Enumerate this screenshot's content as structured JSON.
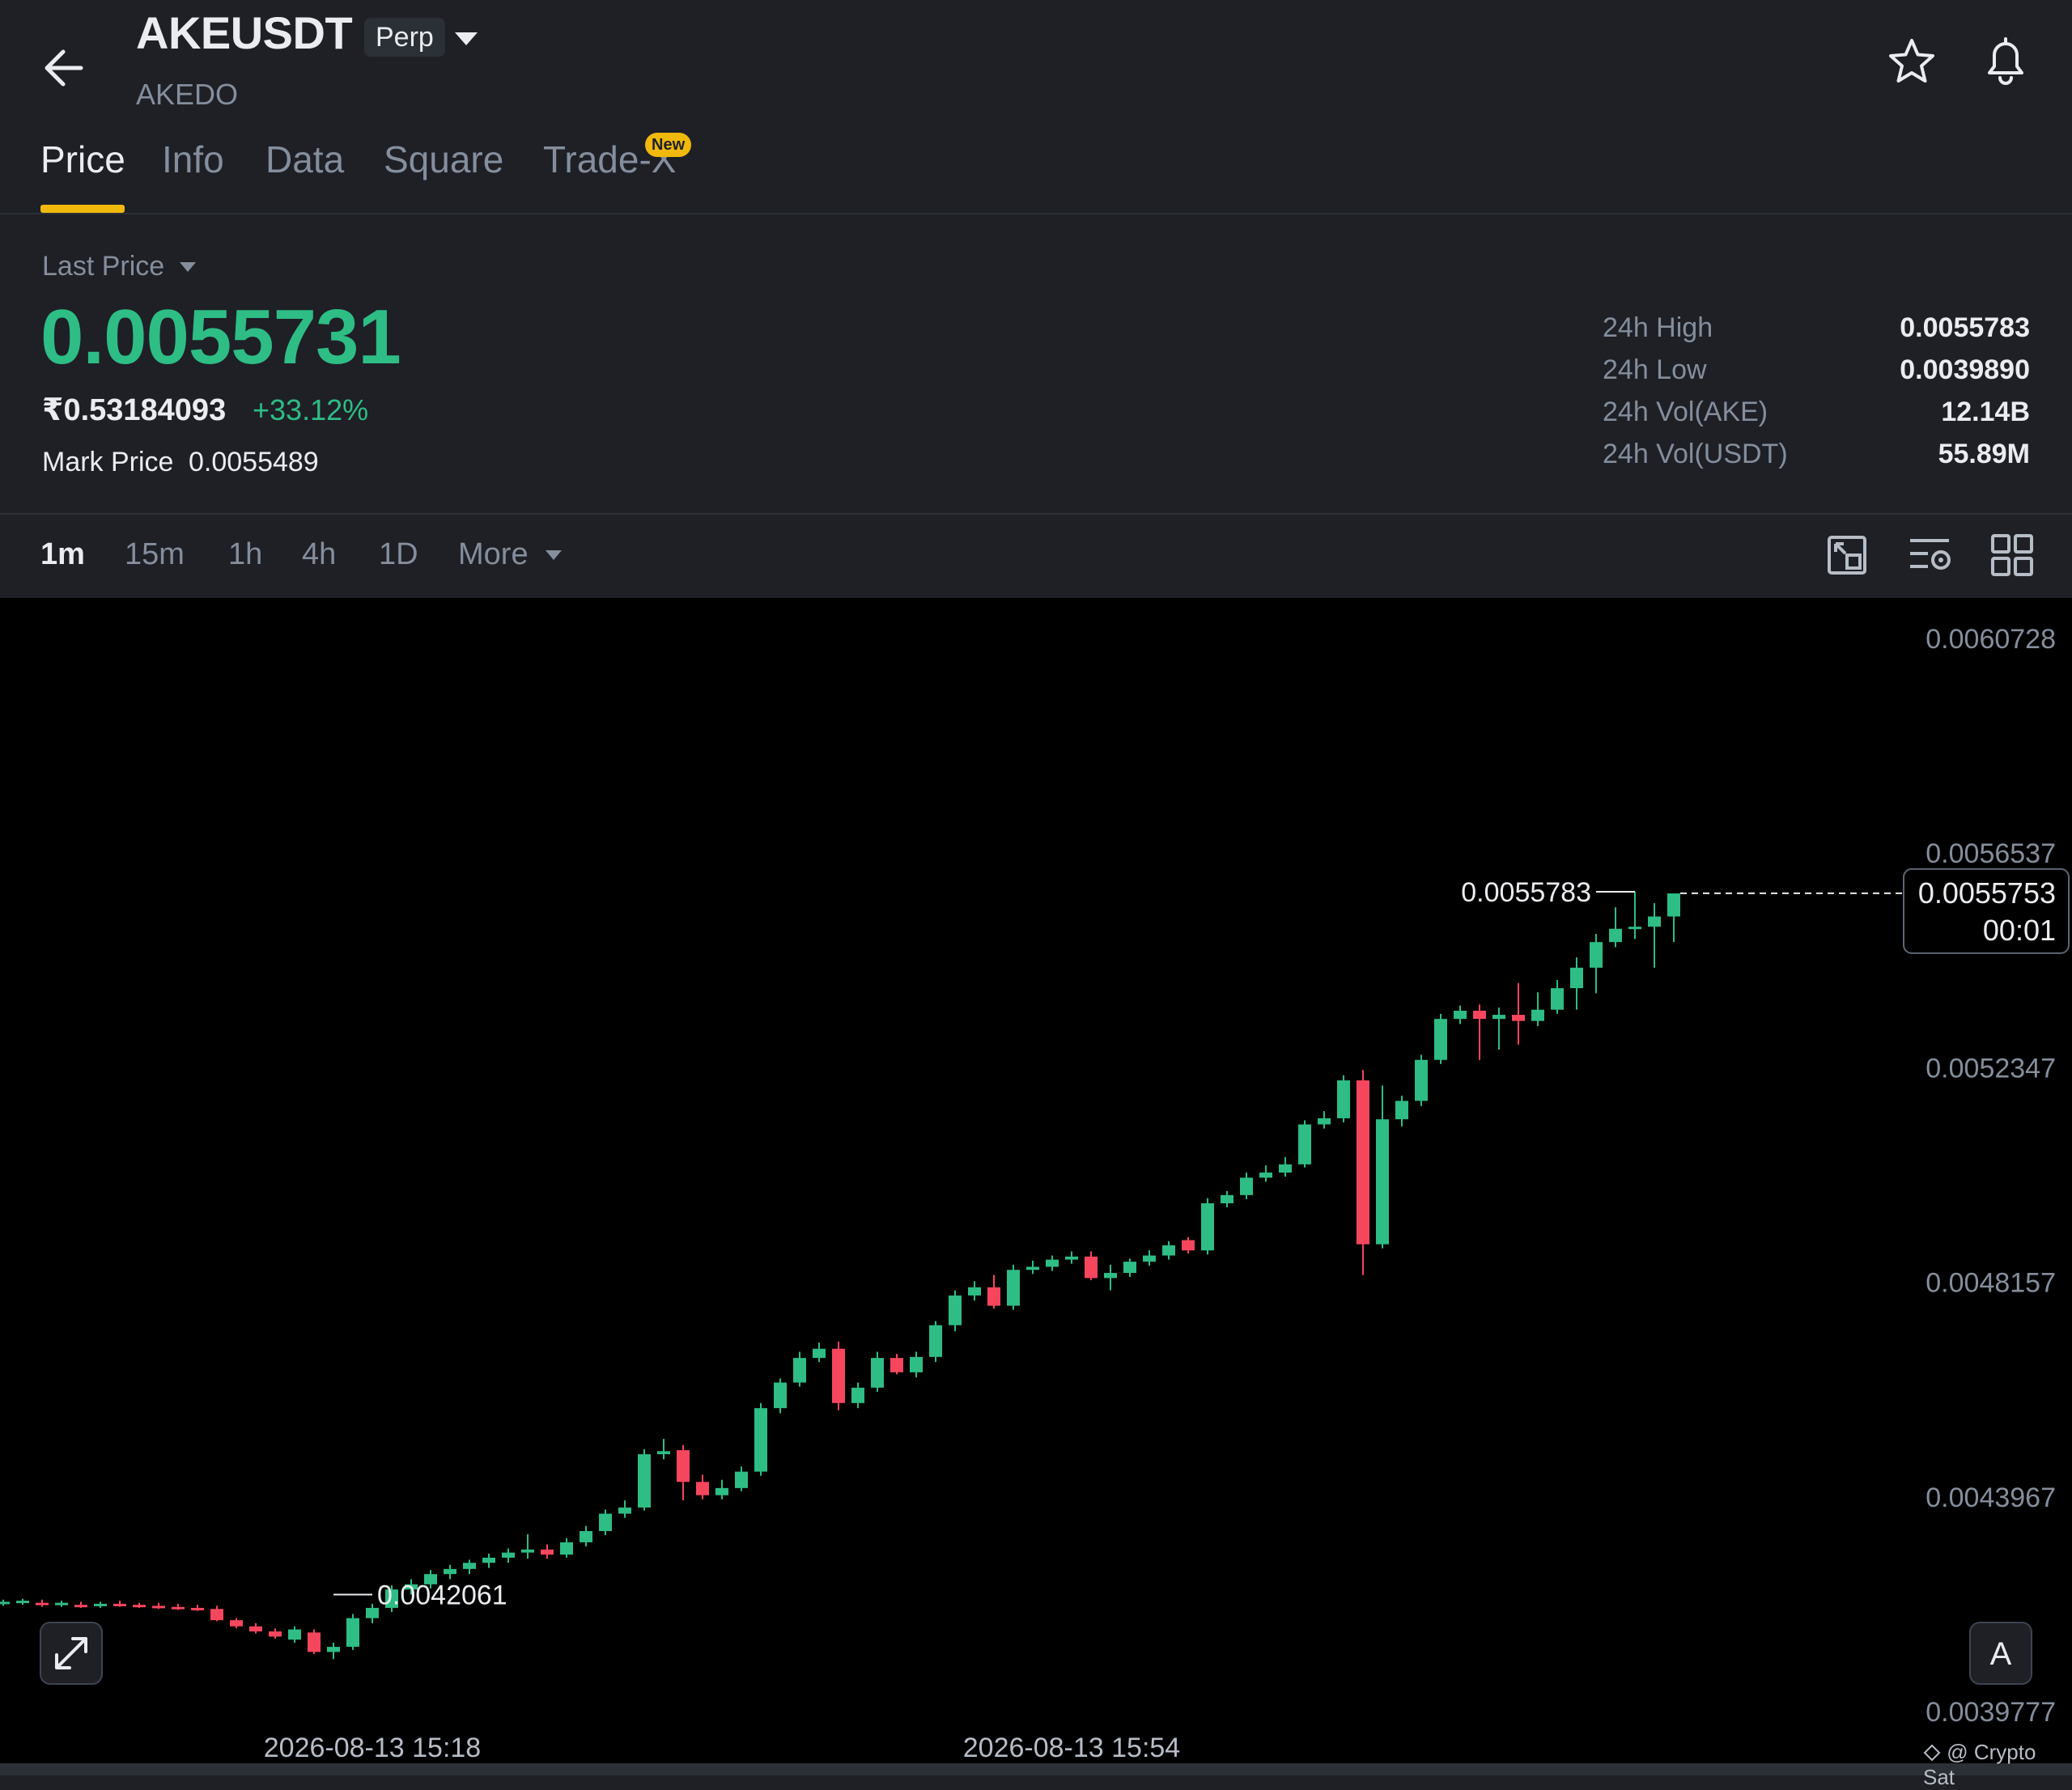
{
  "header": {
    "symbol": "AKEUSDT",
    "contract_type": "Perp",
    "base_name": "AKEDO",
    "icons": [
      "back-arrow-icon",
      "chevron-down-icon",
      "star-icon",
      "bell-icon"
    ]
  },
  "tabs": [
    {
      "label": "Price",
      "active": true
    },
    {
      "label": "Info"
    },
    {
      "label": "Data"
    },
    {
      "label": "Square"
    },
    {
      "label": "Trade-X",
      "badge": "New"
    }
  ],
  "price": {
    "label": "Last Price",
    "last_price": "0.0055731",
    "fiat_price": "₹0.53184093",
    "change_pct": "+33.12%",
    "mark_label": "Mark Price",
    "mark_price": "0.0055489"
  },
  "stats": [
    {
      "label": "24h High",
      "value": "0.0055783"
    },
    {
      "label": "24h Low",
      "value": "0.0039890"
    },
    {
      "label": "24h Vol(AKE)",
      "value": "12.14B"
    },
    {
      "label": "24h Vol(USDT)",
      "value": "55.89M"
    }
  ],
  "intervals": [
    {
      "label": "1m",
      "active": true
    },
    {
      "label": "15m"
    },
    {
      "label": "1h"
    },
    {
      "label": "4h"
    },
    {
      "label": "1D"
    },
    {
      "label": "More"
    }
  ],
  "colors": {
    "up": "#2ebd85",
    "down": "#f6465d",
    "accent": "#f0b90b",
    "bg": "#1e2026",
    "chart_bg": "#000000"
  },
  "chart_data": {
    "type": "candlestick",
    "y_ticks": [
      "0.0060728",
      "0.0056537",
      "0.0052347",
      "0.0048157",
      "0.0043967",
      "0.0039777"
    ],
    "ylim": [
      0.0039777,
      0.0060728
    ],
    "x_ticks": [
      {
        "label": "2026-08-13 15:18",
        "index": 19
      },
      {
        "label": "2026-08-13 15:54",
        "index": 55
      }
    ],
    "current_price": "0.0055753",
    "countdown": "00:01",
    "high_marker": "0.0055783",
    "low_marker": "0.0042061",
    "candles": [
      {
        "o": 0.00419,
        "h": 0.004196,
        "l": 0.004184,
        "c": 0.004192
      },
      {
        "o": 0.004192,
        "h": 0.004198,
        "l": 0.004186,
        "c": 0.004194
      },
      {
        "o": 0.00419,
        "h": 0.004196,
        "l": 0.004182,
        "c": 0.004186
      },
      {
        "o": 0.004186,
        "h": 0.004194,
        "l": 0.004182,
        "c": 0.00419
      },
      {
        "o": 0.004186,
        "h": 0.004192,
        "l": 0.00418,
        "c": 0.004182
      },
      {
        "o": 0.004184,
        "h": 0.004192,
        "l": 0.00418,
        "c": 0.004188
      },
      {
        "o": 0.004188,
        "h": 0.004194,
        "l": 0.004182,
        "c": 0.004186
      },
      {
        "o": 0.004186,
        "h": 0.00419,
        "l": 0.00418,
        "c": 0.004184
      },
      {
        "o": 0.004184,
        "h": 0.00419,
        "l": 0.004178,
        "c": 0.004182
      },
      {
        "o": 0.004182,
        "h": 0.004188,
        "l": 0.004176,
        "c": 0.00418
      },
      {
        "o": 0.00418,
        "h": 0.004186,
        "l": 0.004174,
        "c": 0.004178
      },
      {
        "o": 0.004178,
        "h": 0.004184,
        "l": 0.004154,
        "c": 0.004156
      },
      {
        "o": 0.004156,
        "h": 0.00416,
        "l": 0.00414,
        "c": 0.004144
      },
      {
        "o": 0.004144,
        "h": 0.00415,
        "l": 0.00413,
        "c": 0.004134
      },
      {
        "o": 0.004134,
        "h": 0.00414,
        "l": 0.00412,
        "c": 0.004124
      },
      {
        "o": 0.004118,
        "h": 0.004144,
        "l": 0.004112,
        "c": 0.004138
      },
      {
        "o": 0.004132,
        "h": 0.004138,
        "l": 0.00409,
        "c": 0.004094
      },
      {
        "o": 0.004094,
        "h": 0.004112,
        "l": 0.00408,
        "c": 0.004104
      },
      {
        "o": 0.004104,
        "h": 0.004168,
        "l": 0.004098,
        "c": 0.00416
      },
      {
        "o": 0.00416,
        "h": 0.004188,
        "l": 0.00415,
        "c": 0.00418
      },
      {
        "o": 0.00418,
        "h": 0.004224,
        "l": 0.004172,
        "c": 0.004216
      },
      {
        "o": 0.004216,
        "h": 0.004236,
        "l": 0.004206,
        "c": 0.004226
      },
      {
        "o": 0.004226,
        "h": 0.004254,
        "l": 0.004218,
        "c": 0.004246
      },
      {
        "o": 0.004246,
        "h": 0.004264,
        "l": 0.004236,
        "c": 0.004256
      },
      {
        "o": 0.004256,
        "h": 0.004274,
        "l": 0.004246,
        "c": 0.004268
      },
      {
        "o": 0.004268,
        "h": 0.004286,
        "l": 0.004258,
        "c": 0.004278
      },
      {
        "o": 0.004278,
        "h": 0.004296,
        "l": 0.004268,
        "c": 0.004288
      },
      {
        "o": 0.004288,
        "h": 0.004324,
        "l": 0.004276,
        "c": 0.004294
      },
      {
        "o": 0.004294,
        "h": 0.004304,
        "l": 0.004276,
        "c": 0.004284
      },
      {
        "o": 0.004284,
        "h": 0.004316,
        "l": 0.004278,
        "c": 0.004308
      },
      {
        "o": 0.004308,
        "h": 0.00434,
        "l": 0.0043,
        "c": 0.00433
      },
      {
        "o": 0.00433,
        "h": 0.004372,
        "l": 0.004322,
        "c": 0.004364
      },
      {
        "o": 0.004364,
        "h": 0.00439,
        "l": 0.004356,
        "c": 0.004376
      },
      {
        "o": 0.004376,
        "h": 0.00449,
        "l": 0.00437,
        "c": 0.00448
      },
      {
        "o": 0.00448,
        "h": 0.00451,
        "l": 0.00447,
        "c": 0.004486
      },
      {
        "o": 0.004488,
        "h": 0.004498,
        "l": 0.00439,
        "c": 0.004426
      },
      {
        "o": 0.004426,
        "h": 0.00444,
        "l": 0.004392,
        "c": 0.0044
      },
      {
        "o": 0.0044,
        "h": 0.00443,
        "l": 0.004392,
        "c": 0.004414
      },
      {
        "o": 0.004414,
        "h": 0.004456,
        "l": 0.004408,
        "c": 0.004446
      },
      {
        "o": 0.004446,
        "h": 0.00458,
        "l": 0.004438,
        "c": 0.00457
      },
      {
        "o": 0.00457,
        "h": 0.004628,
        "l": 0.00456,
        "c": 0.00462
      },
      {
        "o": 0.00462,
        "h": 0.00468,
        "l": 0.004612,
        "c": 0.004668
      },
      {
        "o": 0.004668,
        "h": 0.004698,
        "l": 0.00466,
        "c": 0.004686
      },
      {
        "o": 0.004686,
        "h": 0.0047,
        "l": 0.004566,
        "c": 0.00458
      },
      {
        "o": 0.00458,
        "h": 0.00462,
        "l": 0.00457,
        "c": 0.00461
      },
      {
        "o": 0.00461,
        "h": 0.00468,
        "l": 0.004602,
        "c": 0.004668
      },
      {
        "o": 0.004668,
        "h": 0.004676,
        "l": 0.004636,
        "c": 0.00464
      },
      {
        "o": 0.00464,
        "h": 0.00468,
        "l": 0.00463,
        "c": 0.00467
      },
      {
        "o": 0.00467,
        "h": 0.00474,
        "l": 0.00466,
        "c": 0.004732
      },
      {
        "o": 0.004732,
        "h": 0.0048,
        "l": 0.00472,
        "c": 0.00479
      },
      {
        "o": 0.00479,
        "h": 0.004818,
        "l": 0.00478,
        "c": 0.004806
      },
      {
        "o": 0.004806,
        "h": 0.00483,
        "l": 0.004764,
        "c": 0.00477
      },
      {
        "o": 0.00477,
        "h": 0.00485,
        "l": 0.004762,
        "c": 0.00484
      },
      {
        "o": 0.00484,
        "h": 0.004858,
        "l": 0.004832,
        "c": 0.004846
      },
      {
        "o": 0.004846,
        "h": 0.004868,
        "l": 0.004838,
        "c": 0.00486
      },
      {
        "o": 0.00486,
        "h": 0.004876,
        "l": 0.004852,
        "c": 0.004866
      },
      {
        "o": 0.004866,
        "h": 0.004876,
        "l": 0.00482,
        "c": 0.004824
      },
      {
        "o": 0.004824,
        "h": 0.00485,
        "l": 0.0048,
        "c": 0.004834
      },
      {
        "o": 0.004834,
        "h": 0.004862,
        "l": 0.004826,
        "c": 0.004856
      },
      {
        "o": 0.004856,
        "h": 0.004878,
        "l": 0.004848,
        "c": 0.004868
      },
      {
        "o": 0.004868,
        "h": 0.004896,
        "l": 0.00486,
        "c": 0.004888
      },
      {
        "o": 0.004898,
        "h": 0.004904,
        "l": 0.004872,
        "c": 0.004878
      },
      {
        "o": 0.004878,
        "h": 0.00498,
        "l": 0.00487,
        "c": 0.00497
      },
      {
        "o": 0.00497,
        "h": 0.004994,
        "l": 0.004962,
        "c": 0.004986
      },
      {
        "o": 0.004986,
        "h": 0.00503,
        "l": 0.004978,
        "c": 0.00502
      },
      {
        "o": 0.00502,
        "h": 0.005044,
        "l": 0.005012,
        "c": 0.00503
      },
      {
        "o": 0.00503,
        "h": 0.00506,
        "l": 0.005022,
        "c": 0.005046
      },
      {
        "o": 0.005046,
        "h": 0.005132,
        "l": 0.00504,
        "c": 0.005124
      },
      {
        "o": 0.005124,
        "h": 0.00515,
        "l": 0.005116,
        "c": 0.005136
      },
      {
        "o": 0.005136,
        "h": 0.00522,
        "l": 0.005128,
        "c": 0.00521
      },
      {
        "o": 0.00521,
        "h": 0.00523,
        "l": 0.00483,
        "c": 0.00489
      },
      {
        "o": 0.00489,
        "h": 0.0052,
        "l": 0.004882,
        "c": 0.005134
      },
      {
        "o": 0.005134,
        "h": 0.00518,
        "l": 0.00512,
        "c": 0.00517
      },
      {
        "o": 0.00517,
        "h": 0.00526,
        "l": 0.00516,
        "c": 0.00525
      },
      {
        "o": 0.00525,
        "h": 0.00534,
        "l": 0.005242,
        "c": 0.00533
      },
      {
        "o": 0.00533,
        "h": 0.005356,
        "l": 0.00532,
        "c": 0.005346
      },
      {
        "o": 0.005346,
        "h": 0.005358,
        "l": 0.00525,
        "c": 0.00533
      },
      {
        "o": 0.00533,
        "h": 0.005352,
        "l": 0.00527,
        "c": 0.005338
      },
      {
        "o": 0.005338,
        "h": 0.0054,
        "l": 0.00528,
        "c": 0.005326
      },
      {
        "o": 0.005326,
        "h": 0.005382,
        "l": 0.005316,
        "c": 0.005348
      },
      {
        "o": 0.005348,
        "h": 0.005406,
        "l": 0.00534,
        "c": 0.00539
      },
      {
        "o": 0.00539,
        "h": 0.00545,
        "l": 0.005348,
        "c": 0.00543
      },
      {
        "o": 0.00543,
        "h": 0.005496,
        "l": 0.00538,
        "c": 0.00548
      },
      {
        "o": 0.00548,
        "h": 0.005548,
        "l": 0.00547,
        "c": 0.005506
      },
      {
        "o": 0.005506,
        "h": 0.005578,
        "l": 0.005486,
        "c": 0.00551
      },
      {
        "o": 0.00551,
        "h": 0.005556,
        "l": 0.00543,
        "c": 0.00553
      },
      {
        "o": 0.00553,
        "h": 0.00556,
        "l": 0.00548,
        "c": 0.005575
      }
    ]
  },
  "chart_overlay": {
    "expand_icon": "expand-arrows-icon",
    "auto_scale_label": "A",
    "watermark": "@ Crypto Sat"
  }
}
